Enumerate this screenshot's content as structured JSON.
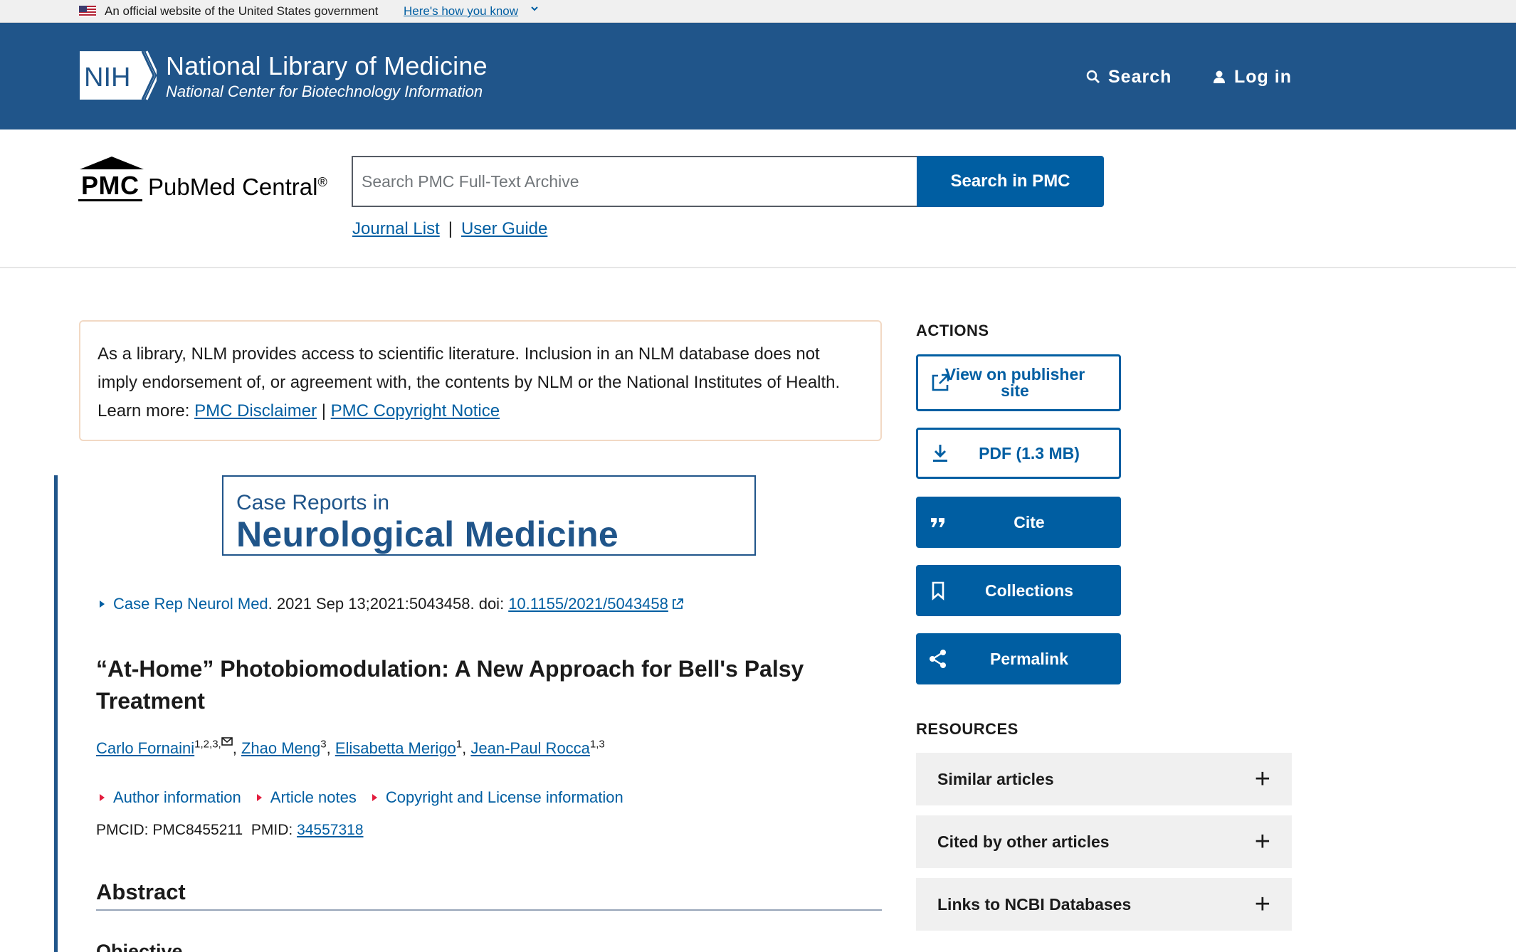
{
  "gov_banner": {
    "text": "An official website of the United States government",
    "link": "Here's how you know"
  },
  "nih": {
    "logo_text": "NIH",
    "title": "National Library of Medicine",
    "subtitle": "National Center for Biotechnology Information",
    "search_label": "Search",
    "login_label": "Log in"
  },
  "pmc": {
    "mark": "PMC",
    "name": "PubMed Central",
    "reg": "®",
    "search_placeholder": "Search PMC Full-Text Archive",
    "search_value": "",
    "search_button": "Search in PMC",
    "links": [
      "Journal List",
      "User Guide"
    ],
    "link_separator": "|"
  },
  "disclaimer": {
    "text": "As a library, NLM provides access to scientific literature. Inclusion in an NLM database does not imply endorsement of, or agreement with, the contents by NLM or the National Institutes of Health.",
    "learn_more": "Learn more:",
    "link1": "PMC Disclaimer",
    "sep": "|",
    "link2": "PMC Copyright Notice"
  },
  "journal_banner": {
    "line1": "Case Reports in",
    "line2": "Neurological Medicine"
  },
  "citation": {
    "journal": "Case Rep Neurol Med",
    "details": ". 2021 Sep 13;2021:5043458. doi: ",
    "doi": "10.1155/2021/5043458"
  },
  "article": {
    "title": "“At-Home” Photobiomodulation: A New Approach for Bell's Palsy Treatment",
    "authors": [
      {
        "name": "Carlo Fornaini",
        "aff": "1,2,3,"
      },
      {
        "name": "Zhao Meng",
        "aff": "3"
      },
      {
        "name": "Elisabetta Merigo",
        "aff": "1"
      },
      {
        "name": "Jean-Paul Rocca",
        "aff": "1,3"
      }
    ],
    "author_separator": ", ",
    "meta_links": [
      "Author information",
      "Article notes",
      "Copyright and License information"
    ],
    "pmcid_label": "PMCID: PMC8455211",
    "pmid_label": "PMID:",
    "pmid": "34557318",
    "abstract_heading": "Abstract",
    "objective_heading": "Objective"
  },
  "sidebar": {
    "actions_heading": "ACTIONS",
    "actions": [
      {
        "label": "View on publisher site",
        "icon": "external-link-icon",
        "style": "outline"
      },
      {
        "label": "PDF (1.3 MB)",
        "icon": "download-icon",
        "style": "outline"
      },
      {
        "label": "Cite",
        "icon": "quote-icon",
        "style": "solid"
      },
      {
        "label": "Collections",
        "icon": "bookmark-icon",
        "style": "solid"
      },
      {
        "label": "Permalink",
        "icon": "share-icon",
        "style": "solid"
      }
    ],
    "resources_heading": "RESOURCES",
    "resources": [
      "Similar articles",
      "Cited by other articles",
      "Links to NCBI Databases"
    ],
    "expand_symbol": "+"
  },
  "colors": {
    "header_blue": "#20558a",
    "primary": "#005ea2",
    "accent_red": "#e31c3d",
    "panel_gray": "#f0f0f0"
  }
}
